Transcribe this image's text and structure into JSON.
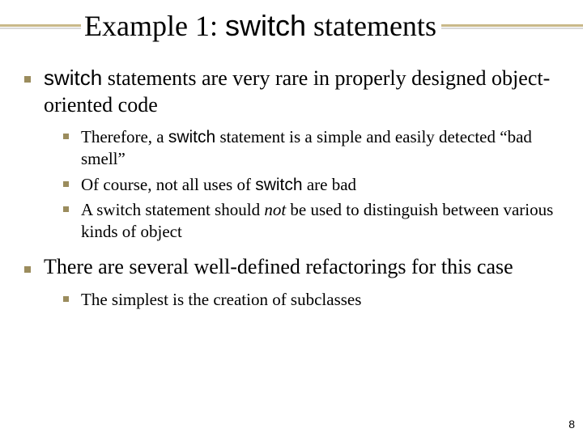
{
  "title": {
    "pre": "Example 1: ",
    "kw": "switch",
    "post": " statements"
  },
  "bullets": [
    {
      "parts": [
        {
          "kw": true,
          "t": "switch"
        },
        {
          "t": " statements are very rare in properly designed object-oriented code"
        }
      ],
      "sub": [
        {
          "parts": [
            {
              "t": "Therefore, a "
            },
            {
              "kw": true,
              "t": "switch"
            },
            {
              "t": " statement is a simple and easily detected “bad smell”"
            }
          ]
        },
        {
          "parts": [
            {
              "t": "Of course, not all uses of "
            },
            {
              "kw": true,
              "t": "switch"
            },
            {
              "t": " are bad"
            }
          ]
        },
        {
          "parts": [
            {
              "t": "A switch statement should "
            },
            {
              "it": true,
              "t": "not"
            },
            {
              "t": " be used to distinguish between various kinds of object"
            }
          ]
        }
      ]
    },
    {
      "parts": [
        {
          "t": "There are several well-defined refactorings for this case"
        }
      ],
      "sub": [
        {
          "parts": [
            {
              "t": "The simplest is the creation of subclasses"
            }
          ]
        }
      ]
    }
  ],
  "page_number": "8"
}
